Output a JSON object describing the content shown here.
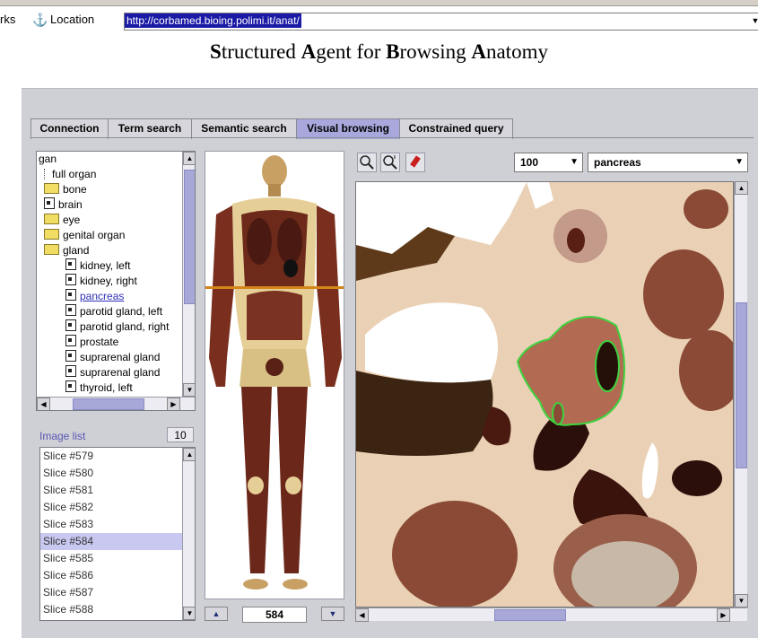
{
  "browser": {
    "bookmarks_label": "rks",
    "location_label": "Location",
    "url": "http://corbamed.bioing.polimi.it/anat/"
  },
  "page": {
    "title_parts": [
      {
        "cap": "S",
        "rest": "tructured "
      },
      {
        "cap": "A",
        "rest": "gent for "
      },
      {
        "cap": "B",
        "rest": "rowsing "
      },
      {
        "cap": "A",
        "rest": "natomy"
      }
    ]
  },
  "tabs": [
    {
      "label": "Connection",
      "active": false
    },
    {
      "label": "Term search",
      "active": false
    },
    {
      "label": "Semantic search",
      "active": false
    },
    {
      "label": "Visual browsing",
      "active": true
    },
    {
      "label": "Constrained query",
      "active": false
    }
  ],
  "tree": {
    "items": [
      {
        "label": "gan",
        "icon": "none",
        "indent": 0
      },
      {
        "label": "full organ",
        "icon": "none",
        "indent": 1
      },
      {
        "label": "bone",
        "icon": "folder-icon",
        "indent": 1
      },
      {
        "label": "brain",
        "icon": "document-icon",
        "indent": 1
      },
      {
        "label": "eye",
        "icon": "folder-icon",
        "indent": 1
      },
      {
        "label": "genital organ",
        "icon": "folder-icon",
        "indent": 1
      },
      {
        "label": "gland",
        "icon": "folder-open-icon",
        "indent": 1
      },
      {
        "label": "kidney, left",
        "icon": "document-icon",
        "indent": 2
      },
      {
        "label": "kidney, right",
        "icon": "document-icon",
        "indent": 2
      },
      {
        "label": "pancreas",
        "icon": "document-icon",
        "indent": 2,
        "selected": true
      },
      {
        "label": "parotid gland, left",
        "icon": "document-icon",
        "indent": 2
      },
      {
        "label": "parotid gland, right",
        "icon": "document-icon",
        "indent": 2
      },
      {
        "label": "prostate",
        "icon": "document-icon",
        "indent": 2
      },
      {
        "label": "suprarenal gland",
        "icon": "document-icon",
        "indent": 2
      },
      {
        "label": "suprarenal gland",
        "icon": "document-icon",
        "indent": 2
      },
      {
        "label": "thyroid, left",
        "icon": "document-icon",
        "indent": 2
      }
    ]
  },
  "image_list": {
    "label": "Image list",
    "count": "10",
    "items": [
      "Slice #579",
      "Slice #580",
      "Slice #581",
      "Slice #582",
      "Slice #583",
      "Slice #584",
      "Slice #585",
      "Slice #586",
      "Slice #587",
      "Slice #588"
    ],
    "selected_index": 5
  },
  "slice_nav": {
    "current_slice": "584",
    "marker_color": "#d4861a"
  },
  "toolbar": {
    "zoom_in_icon": "zoom-in-icon",
    "zoom_out_icon": "zoom-out-icon",
    "eraser_icon": "eraser-icon",
    "zoom_value": "100",
    "organ_value": "pancreas"
  },
  "colors": {
    "active_tab": "#a8a8dc",
    "scroll_thumb": "#a7a7d8",
    "contour": "#3fd23f",
    "tissue": "#ead1b5",
    "dark_tissue": "#5a1f14"
  }
}
